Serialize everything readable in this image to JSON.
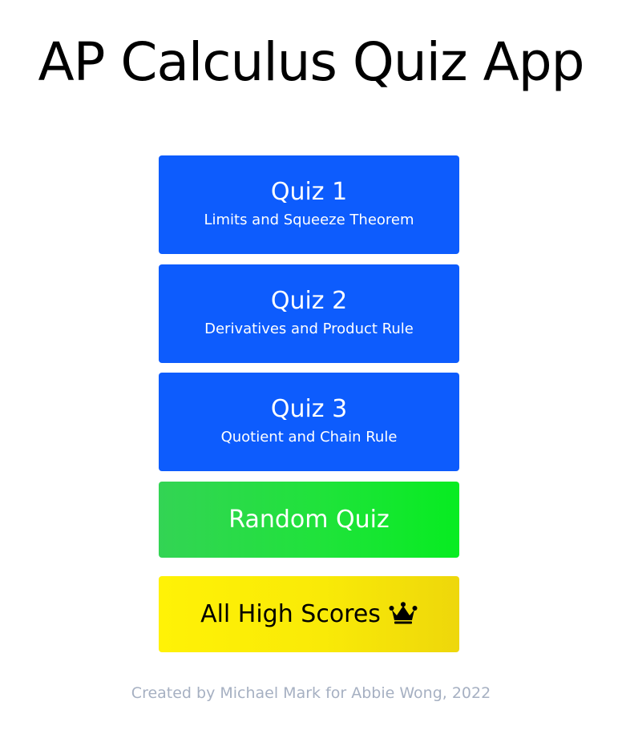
{
  "app": {
    "title": "AP Calculus Quiz App"
  },
  "quizzes": [
    {
      "title": "Quiz 1",
      "subtitle": "Limits and Squeeze Theorem"
    },
    {
      "title": "Quiz 2",
      "subtitle": "Derivatives and Product Rule"
    },
    {
      "title": "Quiz 3",
      "subtitle": "Quotient and Chain Rule"
    }
  ],
  "random": {
    "label": "Random Quiz"
  },
  "high_scores": {
    "label": "All High Scores",
    "icon": "crown-icon"
  },
  "footer": {
    "credit": "Created by Michael Mark for Abbie Wong, 2022"
  },
  "colors": {
    "quiz_button": "#0d5cfd",
    "random_button": "#1fe33a",
    "high_scores_button": "#fff206",
    "footer_text": "#a6b0c2"
  }
}
